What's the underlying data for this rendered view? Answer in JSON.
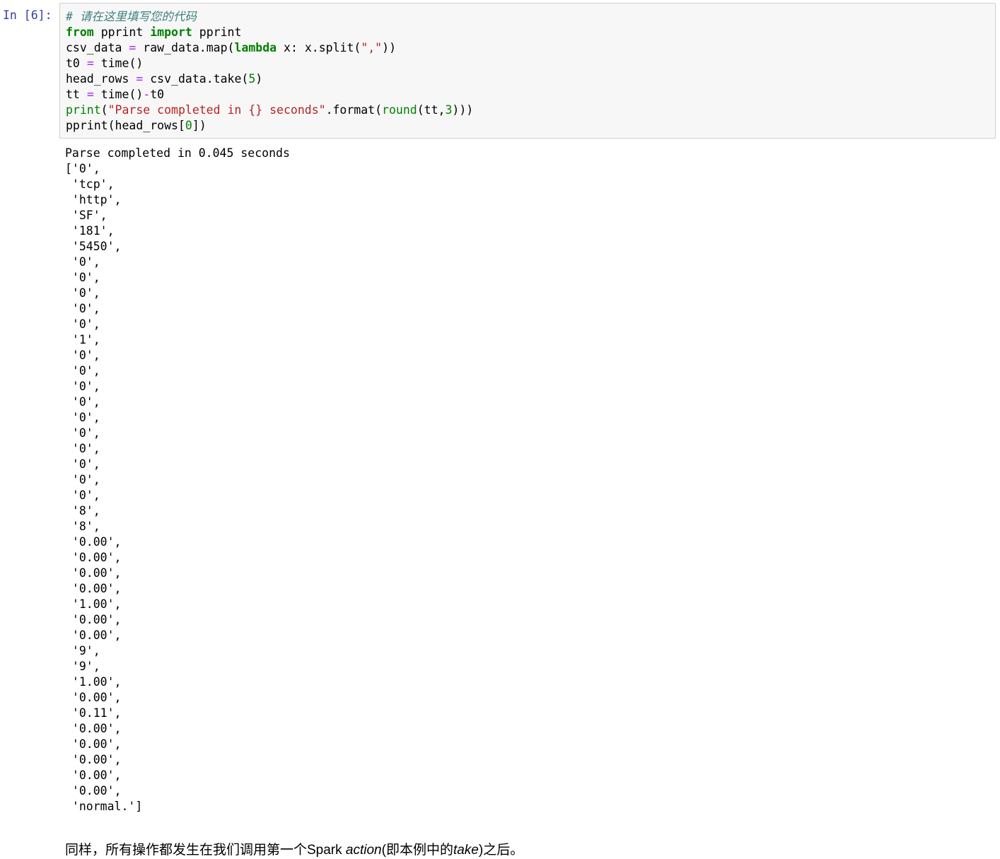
{
  "cell": {
    "prompt": "In [6]:",
    "code_lines": [
      "# 请在这里填写您的代码",
      "from pprint import pprint",
      "csv_data = raw_data.map(lambda x: x.split(\",\"))",
      "t0 = time()",
      "head_rows = csv_data.take(5)",
      "tt = time()-t0",
      "print(\"Parse completed in {} seconds\".format(round(tt,3)))",
      "pprint(head_rows[0])"
    ],
    "output_lines": [
      "Parse completed in 0.045 seconds",
      "['0',",
      " 'tcp',",
      " 'http',",
      " 'SF',",
      " '181',",
      " '5450',",
      " '0',",
      " '0',",
      " '0',",
      " '0',",
      " '0',",
      " '1',",
      " '0',",
      " '0',",
      " '0',",
      " '0',",
      " '0',",
      " '0',",
      " '0',",
      " '0',",
      " '0',",
      " '0',",
      " '8',",
      " '8',",
      " '0.00',",
      " '0.00',",
      " '0.00',",
      " '0.00',",
      " '1.00',",
      " '0.00',",
      " '0.00',",
      " '9',",
      " '9',",
      " '1.00',",
      " '0.00',",
      " '0.11',",
      " '0.00',",
      " '0.00',",
      " '0.00',",
      " '0.00',",
      " '0.00',",
      " 'normal.']"
    ]
  },
  "markdown": {
    "text_before": "同样，所有操作都发生在我们调用第一个Spark ",
    "em1": "action",
    "text_middle": "(即本例中的",
    "em2": "take",
    "text_after": ")之后。"
  }
}
